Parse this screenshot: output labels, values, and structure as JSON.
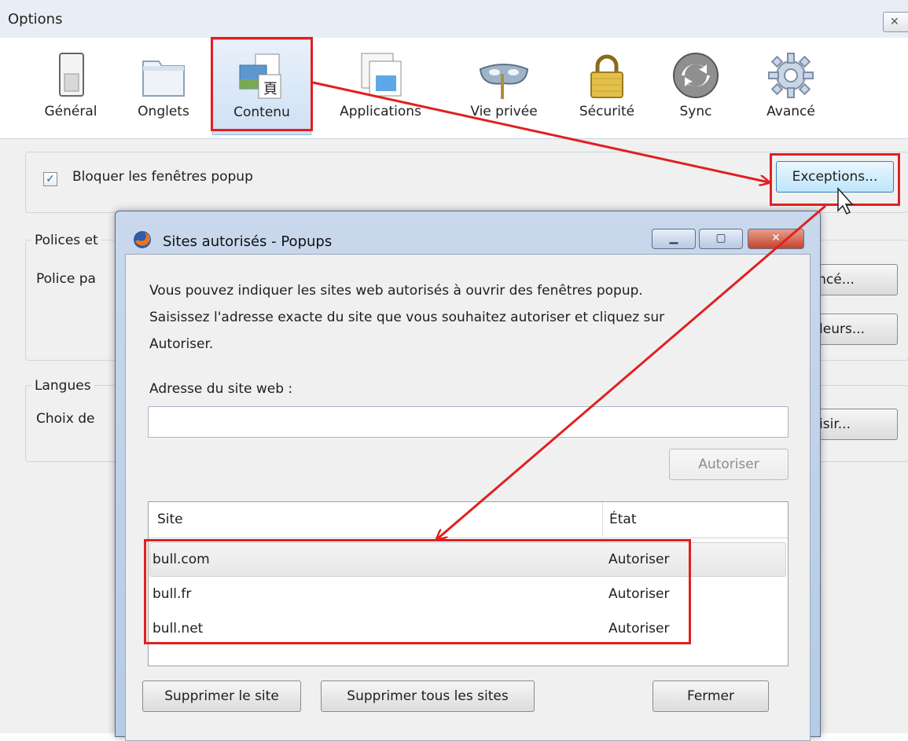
{
  "window": {
    "title": "Options",
    "close_glyph": "✕"
  },
  "toolbar": {
    "items": [
      {
        "label": "Général",
        "icon": "general-icon"
      },
      {
        "label": "Onglets",
        "icon": "tabs-icon"
      },
      {
        "label": "Contenu",
        "icon": "content-icon"
      },
      {
        "label": "Applications",
        "icon": "applications-icon"
      },
      {
        "label": "Vie privée",
        "icon": "privacy-mask-icon"
      },
      {
        "label": "Sécurité",
        "icon": "padlock-icon"
      },
      {
        "label": "Sync",
        "icon": "sync-icon"
      },
      {
        "label": "Avancé",
        "icon": "gear-icon"
      }
    ],
    "selected": "Contenu"
  },
  "content": {
    "block_popups": {
      "label": "Bloquer les fenêtres popup",
      "checked": true
    },
    "exceptions_button": "Exceptions...",
    "fonts_group_label": "Polices et",
    "default_font_label": "Police pa",
    "advanced_button": "Avancé...",
    "colors_button": "Couleurs...",
    "languages_group_label": "Langues",
    "languages_choice_label": "Choix de",
    "choose_button": "Choisir..."
  },
  "dialog": {
    "title": "Sites autorisés - Popups",
    "icon": "firefox-icon",
    "controls": {
      "minimize": "▁",
      "maximize": "▢",
      "close": "✕"
    },
    "description": [
      "Vous pouvez indiquer les sites web autorisés à ouvrir des fenêtres popup.",
      "Saisissez l'adresse exacte du site que vous souhaitez autoriser et cliquez sur",
      "Autoriser."
    ],
    "address_label": "Adresse du site web :",
    "address_value": "",
    "allow_button": "Autoriser",
    "columns": [
      "Site",
      "État"
    ],
    "rows": [
      {
        "site": "bull.com",
        "status": "Autoriser"
      },
      {
        "site": "bull.fr",
        "status": "Autoriser"
      },
      {
        "site": "bull.net",
        "status": "Autoriser"
      }
    ],
    "remove_site_button": "Supprimer le site",
    "remove_all_button": "Supprimer tous les sites",
    "close_button": "Fermer"
  },
  "annotation_color": "#e02020"
}
